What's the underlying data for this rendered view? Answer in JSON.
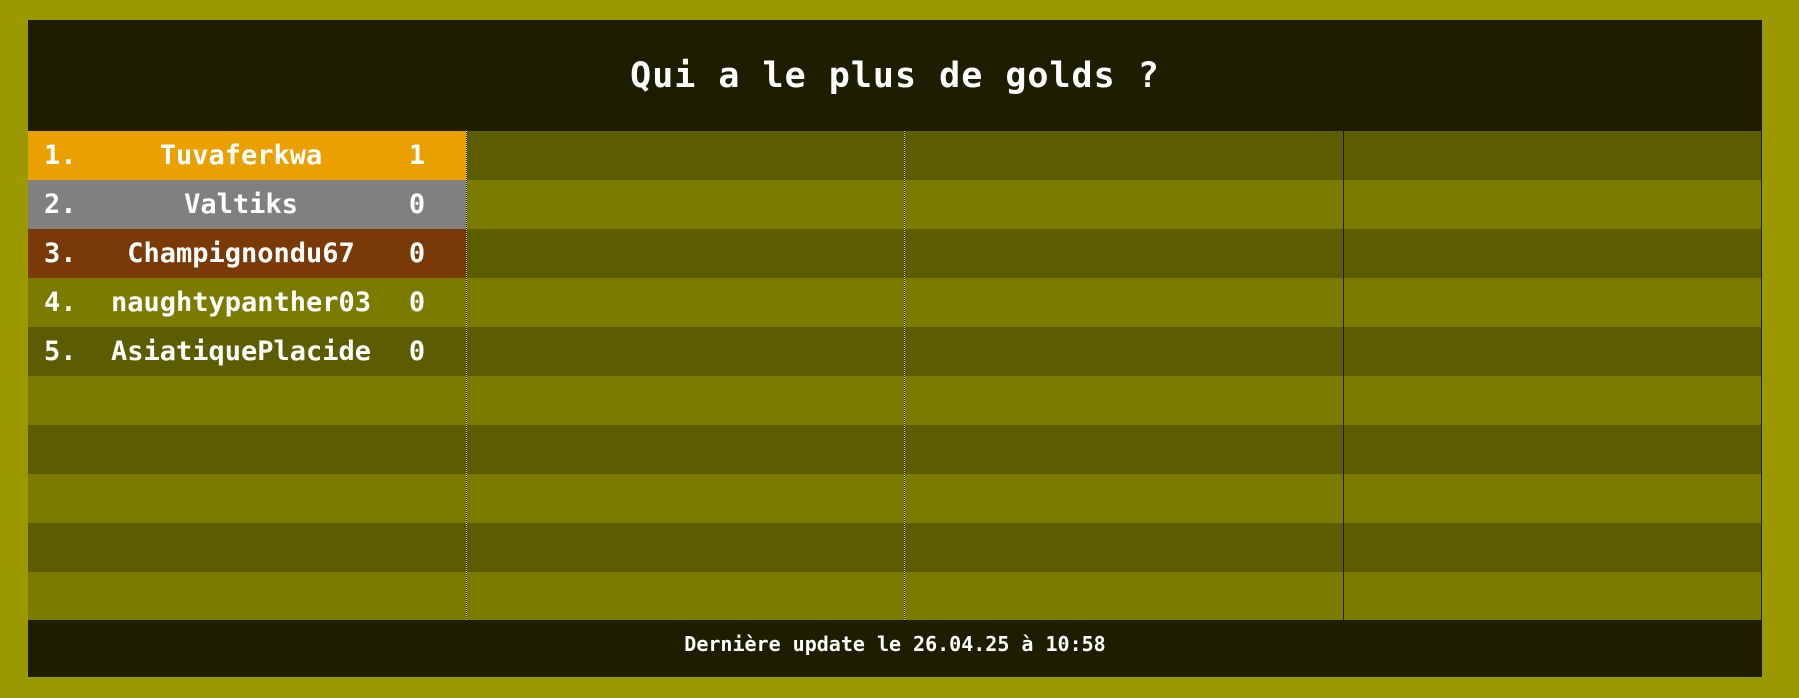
{
  "title": "Qui a le plus de golds ?",
  "leaderboard": [
    {
      "rank": "1.",
      "name": "Tuvaferkwa",
      "score": "1"
    },
    {
      "rank": "2.",
      "name": "Valtiks",
      "score": "0"
    },
    {
      "rank": "3.",
      "name": "Champignondu67",
      "score": "0"
    },
    {
      "rank": "4.",
      "name": "naughtypanther03",
      "score": "0"
    },
    {
      "rank": "5.",
      "name": "AsiatiquePlacide",
      "score": "0"
    }
  ],
  "footer": "Dernière update le 26.04.25 à 10:58",
  "colors": {
    "background": "#9a9a00",
    "panel": "#1d1d00",
    "row_dark": "#5c5c00",
    "row_light": "#7b7b00",
    "gold": "#eaa000",
    "silver": "#808080",
    "bronze": "#7a3a08"
  }
}
